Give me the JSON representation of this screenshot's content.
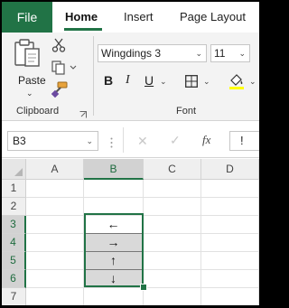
{
  "ribbon_tabs": {
    "file": "File",
    "home": "Home",
    "insert": "Insert",
    "page_layout": "Page Layout"
  },
  "clipboard": {
    "paste_label": "Paste",
    "group_label": "Clipboard"
  },
  "font": {
    "font_name": "Wingdings 3",
    "font_size": "11",
    "bold_label": "B",
    "italic_label": "I",
    "underline_label": "U",
    "group_label": "Font"
  },
  "formula_bar": {
    "name_box": "B3",
    "cancel_symbol": "✕",
    "enter_symbol": "✓",
    "fx_label": "fx",
    "formula_value": "!"
  },
  "columns": [
    "A",
    "B",
    "C",
    "D"
  ],
  "rows": [
    "1",
    "2",
    "3",
    "4",
    "5",
    "6",
    "7"
  ],
  "cells": {
    "B3": "←",
    "B4": "→",
    "B5": "↑",
    "B6": "↓"
  },
  "colors": {
    "accent": "#217346",
    "selected_fill": "#d9d9d9"
  },
  "icons": [
    "clipboard-paste-icon",
    "scissors-icon",
    "copy-icon",
    "format-painter-icon",
    "borders-icon",
    "fill-color-icon",
    "dialog-launcher-icon"
  ]
}
